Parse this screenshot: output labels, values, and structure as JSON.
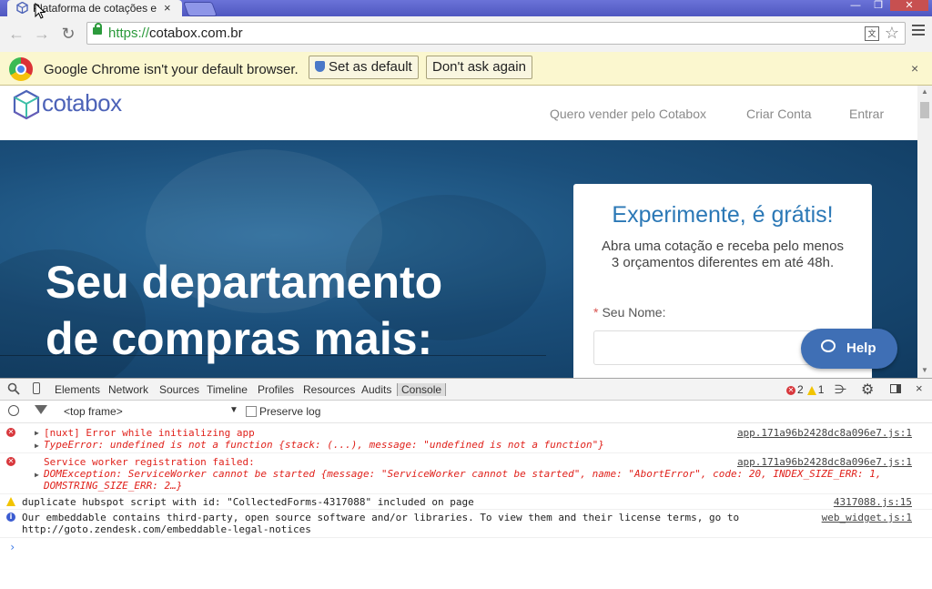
{
  "browser": {
    "tab_title": "Plataforma de cotações e",
    "tab_close": "×",
    "url_scheme": "https://",
    "url_host": "cotabox.com.br",
    "window_controls": [
      "—",
      "❐",
      "✕"
    ]
  },
  "infobar": {
    "message": "Google Chrome isn't your default browser.",
    "set_default": "Set as default",
    "dont_ask": "Don't ask again",
    "close": "×"
  },
  "site": {
    "logo": "cotabox",
    "nav": [
      "Quero vender pelo Cotabox",
      "Criar Conta",
      "Entrar"
    ],
    "hero_title_line1": "Seu departamento",
    "hero_title_line2": "de compras mais:",
    "card_title": "Experimente, é grátis!",
    "card_subtitle_line1": "Abra uma cotação e receba pelo menos",
    "card_subtitle_line2": "3 orçamentos diferentes em até 48h.",
    "name_required_mark": "*",
    "name_label": "Seu Nome:",
    "help": "Help",
    "brand_color": "#4d63b8"
  },
  "devtools": {
    "tabs": [
      "Elements",
      "Network",
      "Sources",
      "Timeline",
      "Profiles",
      "Resources",
      "Audits",
      "Console"
    ],
    "error_count": "2",
    "warning_count": "1",
    "frame": "<top frame>",
    "preserve_log": "Preserve log",
    "messages": [
      {
        "level": "error",
        "lines": [
          "[nuxt] Error while initializing app",
          "TypeError: undefined is not a function {stack: (...), message: \"undefined is not a function\"}"
        ],
        "source": "app.171a96b2428dc8a096e7.js:1"
      },
      {
        "level": "error",
        "lines": [
          "Service worker registration failed:",
          "DOMException: ServiceWorker cannot be started {message: \"ServiceWorker cannot be started\", name: \"AbortError\", code: 20, INDEX_SIZE_ERR: 1,",
          "DOMSTRING_SIZE_ERR: 2…}"
        ],
        "source": "app.171a96b2428dc8a096e7.js:1"
      },
      {
        "level": "warning",
        "lines": [
          "duplicate hubspot script with id: \"CollectedForms-4317088\" included on page"
        ],
        "source": "4317088.js:15"
      },
      {
        "level": "info",
        "lines": [
          "Our embeddable contains third-party, open source software and/or libraries. To view them and their license terms, go to",
          "http://goto.zendesk.com/embeddable-legal-notices"
        ],
        "source": "web_widget.js:1"
      }
    ],
    "prompt": "›"
  }
}
